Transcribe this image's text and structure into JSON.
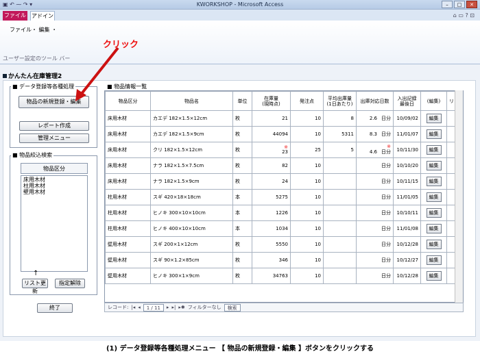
{
  "window": {
    "title": "KWORKSHOP - Microsoft Access",
    "qat": "▣ ↶ ⁓ ↷ ▾"
  },
  "ribbon": {
    "tab_file": "ファイル",
    "tab_addin": "アドイン",
    "menu": "ファイル・ 編集 ・",
    "group_label": "ユーザー設定のツール バー",
    "right_controls": "⌂ ▭ ? ⊡"
  },
  "callout": {
    "text": "クリック",
    "color": "#ee1111"
  },
  "form": {
    "title": "かんたん在庫管理2",
    "section_data": "■ データ登録等各種処理",
    "btn_new": "物品の新規登録・編集",
    "btn_report": "レポート作成",
    "btn_admin": "管理メニュー",
    "section_filter": "■ 物品絞込検索",
    "listbox_header": "物品区分",
    "listbox_items": [
      "床用木材",
      "柱用木材",
      "壁用木材"
    ],
    "list_arrow": "↑",
    "btn_refresh": "リスト更新",
    "btn_clear": "指定解除",
    "btn_exit": "終了",
    "section_list": "■ 物品情報一覧"
  },
  "table": {
    "headers": [
      "物品区分",
      "物品名",
      "単位",
      "在庫量\n(現時点)",
      "発注点",
      "平均出庫量\n(1日あたり)",
      "出庫対応日数",
      "入出記録\n最後日",
      "(編集)",
      "リ"
    ],
    "rows": [
      [
        "床用木材",
        "カエデ 182×1.5×12cm",
        "枚",
        "21",
        "10",
        "8",
        "2.6",
        "日分",
        "10/09/02",
        "編集",
        ""
      ],
      [
        "床用木材",
        "カエデ 182×1.5×9cm",
        "枚",
        "44094",
        "10",
        "5311",
        "8.3",
        "日分",
        "11/01/07",
        "編集",
        ""
      ],
      [
        "床用木材",
        "クリ 182×1.5×12cm",
        "枚",
        "23",
        "25",
        "5",
        "4.6",
        "日分",
        "10/11/30",
        "編集",
        "※"
      ],
      [
        "床用木材",
        "ナラ 182×1.5×7.5cm",
        "枚",
        "82",
        "10",
        "",
        "",
        "日分",
        "10/10/20",
        "編集",
        ""
      ],
      [
        "床用木材",
        "ナラ 182×1.5×9cm",
        "枚",
        "24",
        "10",
        "",
        "",
        "日分",
        "10/11/15",
        "編集",
        ""
      ],
      [
        "柱用木材",
        "スギ 420×18×18cm",
        "本",
        "5275",
        "10",
        "",
        "",
        "日分",
        "11/01/05",
        "編集",
        ""
      ],
      [
        "柱用木材",
        "ヒノキ 300×10×10cm",
        "本",
        "1226",
        "10",
        "",
        "",
        "日分",
        "10/10/11",
        "編集",
        ""
      ],
      [
        "柱用木材",
        "ヒノキ 400×10×10cm",
        "本",
        "1034",
        "10",
        "",
        "",
        "日分",
        "11/01/08",
        "編集",
        ""
      ],
      [
        "壁用木材",
        "スギ 200×1×12cm",
        "枚",
        "5550",
        "10",
        "",
        "",
        "日分",
        "10/12/28",
        "編集",
        ""
      ],
      [
        "壁用木材",
        "スギ 90×1.2×85cm",
        "枚",
        "346",
        "10",
        "",
        "",
        "日分",
        "10/12/27",
        "編集",
        ""
      ],
      [
        "壁用木材",
        "ヒノキ 300×1×9cm",
        "枚",
        "34763",
        "10",
        "",
        "",
        "日分",
        "10/12/28",
        "編集",
        ""
      ]
    ]
  },
  "navbar": {
    "label": "レコード:",
    "nav_first": "|◂",
    "nav_prev": "◂",
    "position": "1 / 11",
    "nav_next": "▸",
    "nav_last": "▸|",
    "nav_new": "▸✱",
    "filter": "フィルターなし",
    "search": "検索"
  },
  "caption": "(1) データ登録等各種処理メニュー 【 物品の新規登録・編集 】ボタンをクリックする"
}
